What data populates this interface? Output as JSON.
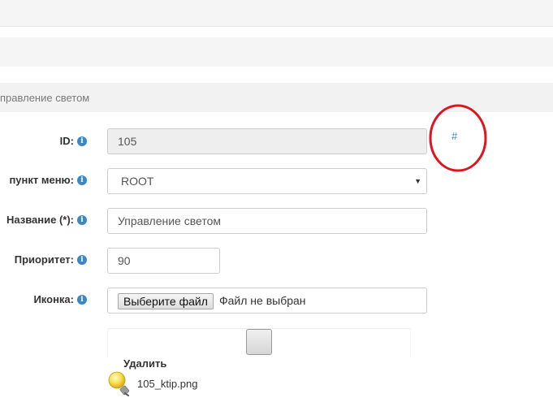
{
  "header": {
    "page_title": "правление светом"
  },
  "form": {
    "id": {
      "label": "ID:",
      "value": "105"
    },
    "parent_menu": {
      "label": "пункт меню:",
      "value": "ROOT",
      "options": [
        "ROOT"
      ]
    },
    "name": {
      "label": "Название (*):",
      "value": "Управление светом"
    },
    "priority": {
      "label": "Приоритет:",
      "value": "90"
    },
    "icon": {
      "label": "Иконка:",
      "choose_button": "Выберите файл",
      "status": "Файл не выбран",
      "delete_label": "Удалить",
      "current_file": "105_ktip.png"
    },
    "hash_link": "#"
  },
  "icons": {
    "info": "info-icon",
    "select_arrow": "chevron-down-icon",
    "bulb": "lightbulb-icon"
  },
  "colors": {
    "accent": "#3a87c8",
    "annotation": "#e0141e",
    "readonly_bg": "#eeeeee"
  }
}
